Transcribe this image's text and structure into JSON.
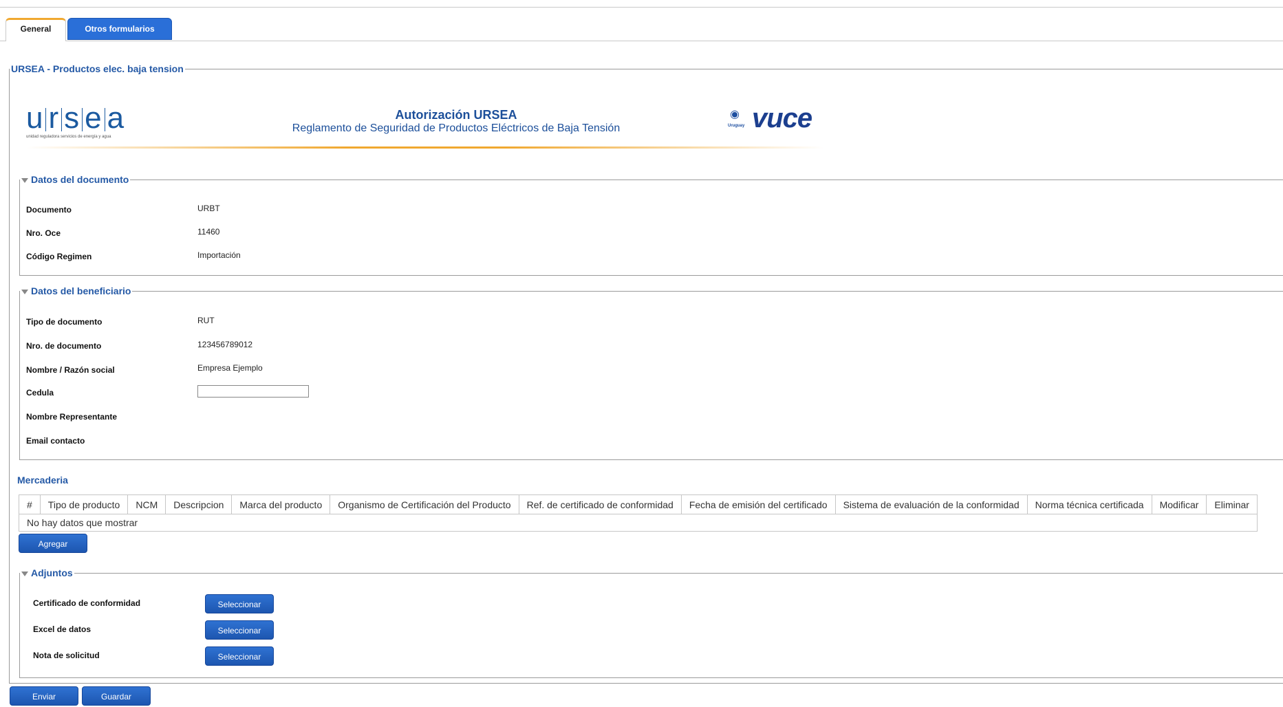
{
  "tabs": [
    {
      "label": "General",
      "active": true
    },
    {
      "label": "Otros formularios",
      "active": false
    }
  ],
  "form_legend": "URSEA - Productos elec. baja tension",
  "header": {
    "ursea_logo_text": "ursea",
    "ursea_tagline": "unidad reguladora servicios de energía y agua",
    "title": "Autorización URSEA",
    "subtitle": "Reglamento de Seguridad de Productos Eléctricos de Baja Tensión",
    "vuce_logo_text": "vuce",
    "vuce_country": "Uruguay"
  },
  "datos_documento": {
    "legend": "Datos del documento",
    "fields": [
      {
        "label": "Documento",
        "value": "URBT"
      },
      {
        "label": "Nro. Oce",
        "value": "11460"
      },
      {
        "label": "Código Regimen",
        "value": "Importación"
      }
    ]
  },
  "datos_beneficiario": {
    "legend": "Datos del beneficiario",
    "fields": [
      {
        "label": "Tipo de documento",
        "value": "RUT"
      },
      {
        "label": "Nro. de documento",
        "value": "123456789012"
      },
      {
        "label": "Nombre / Razón social",
        "value": "Empresa Ejemplo"
      },
      {
        "label": "Cedula",
        "value": ""
      },
      {
        "label": "Nombre Representante",
        "value": ""
      },
      {
        "label": "Email contacto",
        "value": ""
      }
    ]
  },
  "mercaderia": {
    "title": "Mercaderia",
    "columns": [
      "#",
      "Tipo de producto",
      "NCM",
      "Descripcion",
      "Marca del producto",
      "Organismo de Certificación del Producto",
      "Ref. de certificado de conformidad",
      "Fecha de emisión del certificado",
      "Sistema de evaluación de la conformidad",
      "Norma técnica certificada",
      "Modificar",
      "Eliminar"
    ],
    "empty_message": "No hay datos que mostrar",
    "add_button": "Agregar"
  },
  "adjuntos": {
    "legend": "Adjuntos",
    "items": [
      {
        "label": "Certificado de conformidad",
        "button": "Seleccionar"
      },
      {
        "label": "Excel de datos",
        "button": "Seleccionar"
      },
      {
        "label": "Nota de solicitud",
        "button": "Seleccionar"
      }
    ]
  },
  "footer": {
    "send_button": "Enviar",
    "save_button": "Guardar"
  },
  "colors": {
    "accent_blue": "#2459a6",
    "button_blue": "#1d56b0",
    "tab_highlight": "#f0a830"
  }
}
